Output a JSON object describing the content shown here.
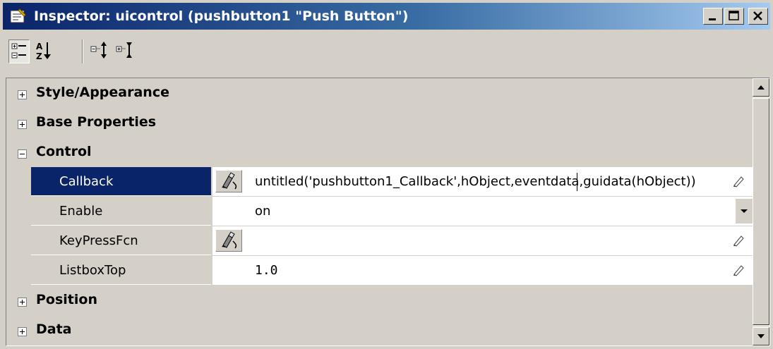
{
  "window": {
    "title": "Inspector:  uicontrol (pushbutton1 \"Push Button\")",
    "title_icon": "inspector-icon",
    "controls": [
      "minimize-icon",
      "maximize-icon",
      "close-icon"
    ]
  },
  "toolbar": {
    "buttons": [
      {
        "icon": "categorized-view-icon",
        "pressed": true
      },
      {
        "icon": "sort-alphabetical-icon",
        "pressed": false
      },
      {
        "icon": "expand-all-icon",
        "pressed": false
      },
      {
        "icon": "collapse-all-icon",
        "pressed": false
      }
    ]
  },
  "grid": {
    "categories": [
      {
        "label": "Style/Appearance",
        "expanded": false
      },
      {
        "label": "Base Properties",
        "expanded": false
      },
      {
        "label": "Control",
        "expanded": true
      },
      {
        "label": "Position",
        "expanded": false
      },
      {
        "label": "Data",
        "expanded": false
      }
    ],
    "properties": [
      {
        "name": "Callback",
        "value": "untitled('pushbutton1_Callback',hObject,eventdata,guidata(hObject))",
        "selected": true,
        "edit_button": true,
        "control": "pencil-icon"
      },
      {
        "name": "Enable",
        "value": "on",
        "selected": false,
        "edit_button": false,
        "control": "dropdown-arrow-icon"
      },
      {
        "name": "KeyPressFcn",
        "value": "",
        "selected": false,
        "edit_button": true,
        "control": "pencil-icon"
      },
      {
        "name": "ListboxTop",
        "value": "1.0",
        "selected": false,
        "edit_button": false,
        "control": "pencil-icon"
      }
    ]
  },
  "colors": {
    "title_bar_start": "#0a246a",
    "title_bar_end": "#a6caf0",
    "selected_row": "#0a246a",
    "window_face": "#d4d0c8"
  }
}
